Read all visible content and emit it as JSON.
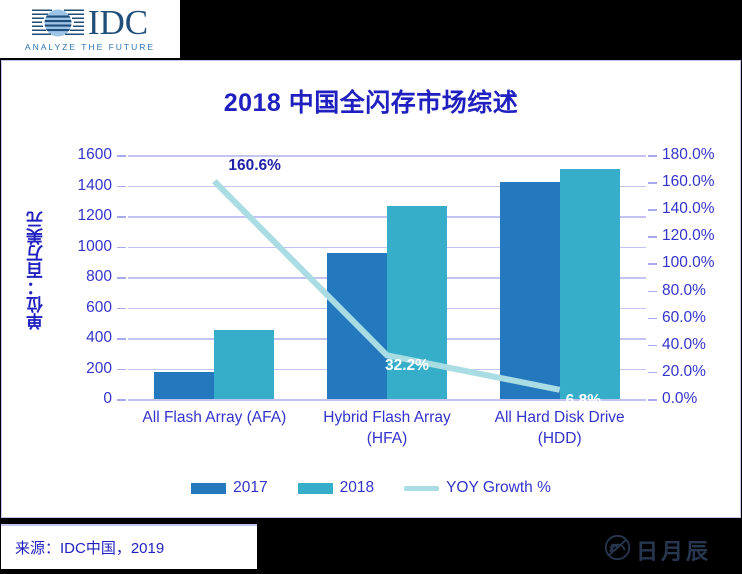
{
  "brand": {
    "logo_word": "IDC",
    "logo_tagline": "ANALYZE THE FUTURE",
    "logo_icon": "idc-globe-icon"
  },
  "footer": {
    "source_text": "来源：IDC中国，2019",
    "watermark_text": "日月辰",
    "watermark_icon": "riyuechen-seal-icon"
  },
  "colors": {
    "series_2017": "#2479BE",
    "series_2018": "#36AEC9",
    "growth_line": "#A9DCE3",
    "axis_text": "#3333CC",
    "title_text": "#2020C0",
    "grid": "#C3C4F4"
  },
  "chart_data": {
    "type": "bar",
    "title": "2018 中国全闪存市场综述",
    "xlabel": "",
    "ylabel": "单位：百万美元",
    "y2label": "",
    "categories": [
      "All Flash Array (AFA)",
      "Hybrid Flash Array (HFA)",
      "All Hard Disk Drive (HDD)"
    ],
    "category_lines": [
      [
        "All Flash Array (AFA)"
      ],
      [
        "Hybrid Flash Array",
        "(HFA)"
      ],
      [
        "All Hard Disk Drive",
        "(HDD)"
      ]
    ],
    "series": [
      {
        "name": "2017",
        "type": "bar",
        "values": [
          175,
          960,
          1420
        ]
      },
      {
        "name": "2018",
        "type": "bar",
        "values": [
          455,
          1265,
          1510
        ]
      },
      {
        "name": "YOY Growth %",
        "type": "line",
        "axis": "right",
        "values": [
          160.6,
          32.2,
          6.8
        ]
      }
    ],
    "data_labels": [
      "160.6%",
      "32.2%",
      "6.8%"
    ],
    "ylim": [
      0,
      1600
    ],
    "yticks": [
      0,
      200,
      400,
      600,
      800,
      1000,
      1200,
      1400,
      1600
    ],
    "ytick_labels": [
      "0",
      "200",
      "400",
      "600",
      "800",
      "1000",
      "1200",
      "1400",
      "1600"
    ],
    "y2lim": [
      0,
      180
    ],
    "y2ticks": [
      0,
      20,
      40,
      60,
      80,
      100,
      120,
      140,
      160,
      180
    ],
    "y2tick_labels": [
      "0.0%",
      "20.0%",
      "40.0%",
      "60.0%",
      "80.0%",
      "100.0%",
      "120.0%",
      "140.0%",
      "160.0%",
      "180.0%"
    ],
    "grid": true,
    "legend_position": "bottom",
    "legend": [
      "2017",
      "2018",
      "YOY Growth %"
    ]
  }
}
